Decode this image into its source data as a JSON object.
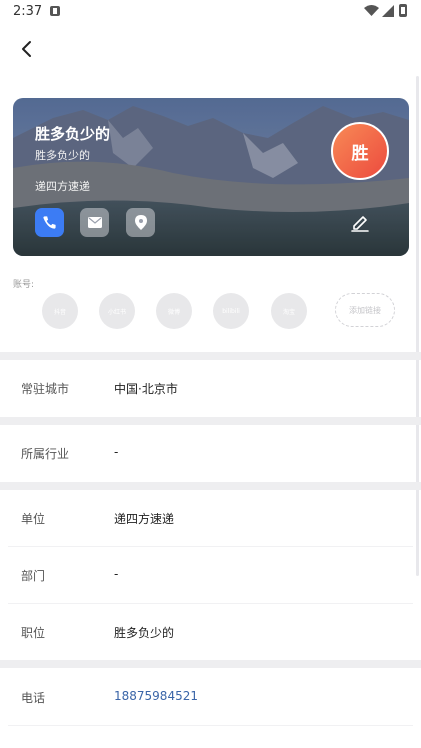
{
  "status_bar": {
    "time": "2:37",
    "notification_icon": "notification-icon",
    "wifi_icon": "wifi-icon",
    "signal_icon": "signal-icon",
    "battery_icon": "battery-icon"
  },
  "header": {
    "back_icon": "chevron-left-icon"
  },
  "card": {
    "name": "胜多负少的",
    "title": "胜多负少的",
    "company": "递四方速递",
    "avatar_text": "胜",
    "avatar_colors": [
      "#f88a56",
      "#ec4a3e"
    ],
    "actions": [
      {
        "icon": "phone-icon",
        "color": "#3c7cf4"
      },
      {
        "icon": "mail-icon"
      },
      {
        "icon": "location-icon"
      }
    ],
    "edit_icon": "edit-icon"
  },
  "accounts": {
    "label": "账号:",
    "items": [
      "抖音",
      "小红书",
      "微博",
      "bilibili",
      "淘宝"
    ],
    "add_label": "添加链接"
  },
  "info": {
    "city": {
      "label": "常驻城市",
      "value": "中国·北京市"
    },
    "industry": {
      "label": "所属行业",
      "value": "-"
    },
    "unit": {
      "label": "单位",
      "value": "递四方速递"
    },
    "department": {
      "label": "部门",
      "value": "-"
    },
    "position": {
      "label": "职位",
      "value": "胜多负少的"
    },
    "phone": {
      "label": "电话",
      "value": "18875984521",
      "color": "#3a65a8"
    }
  }
}
